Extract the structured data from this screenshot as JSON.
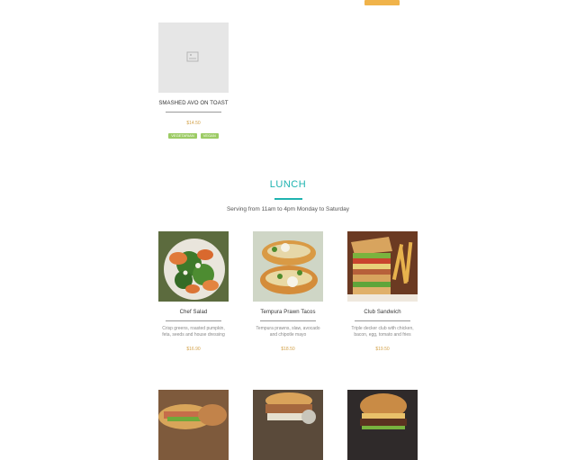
{
  "top": {
    "button_label": ""
  },
  "breakfast_item": {
    "title": "SMASHED AVO ON TOAST",
    "price": "$14.50",
    "tags": [
      "VEGETARIAN",
      "VEGAN"
    ]
  },
  "lunch": {
    "title": "LUNCH",
    "subtitle": "Serving from 11am to 4pm Monday to Saturday",
    "items_row1": [
      {
        "name": "Chef Salad",
        "desc": "Crisp greens, roasted pumpkin, feta, seeds and house dressing",
        "price": "$16.90",
        "image_icon": "salad-photo"
      },
      {
        "name": "Tempura Prawn Tacos",
        "desc": "Tempura prawns, slaw, avocado and chipotle mayo",
        "price": "$18.50",
        "image_icon": "tacos-photo"
      },
      {
        "name": "Club Sandwich",
        "desc": "Triple decker club with chicken, bacon, egg, tomato and fries",
        "price": "$19.50",
        "image_icon": "club-sandwich-photo"
      }
    ],
    "items_row2": [
      {
        "name": "",
        "image_icon": "baguette-photo"
      },
      {
        "name": "",
        "image_icon": "pulled-pork-photo"
      },
      {
        "name": "",
        "image_icon": "burger-photo"
      }
    ]
  },
  "colors": {
    "accent": "#1fb3b0",
    "price": "#d3a24a",
    "tag": "#9ccb64",
    "top_button": "#f0b34a"
  }
}
